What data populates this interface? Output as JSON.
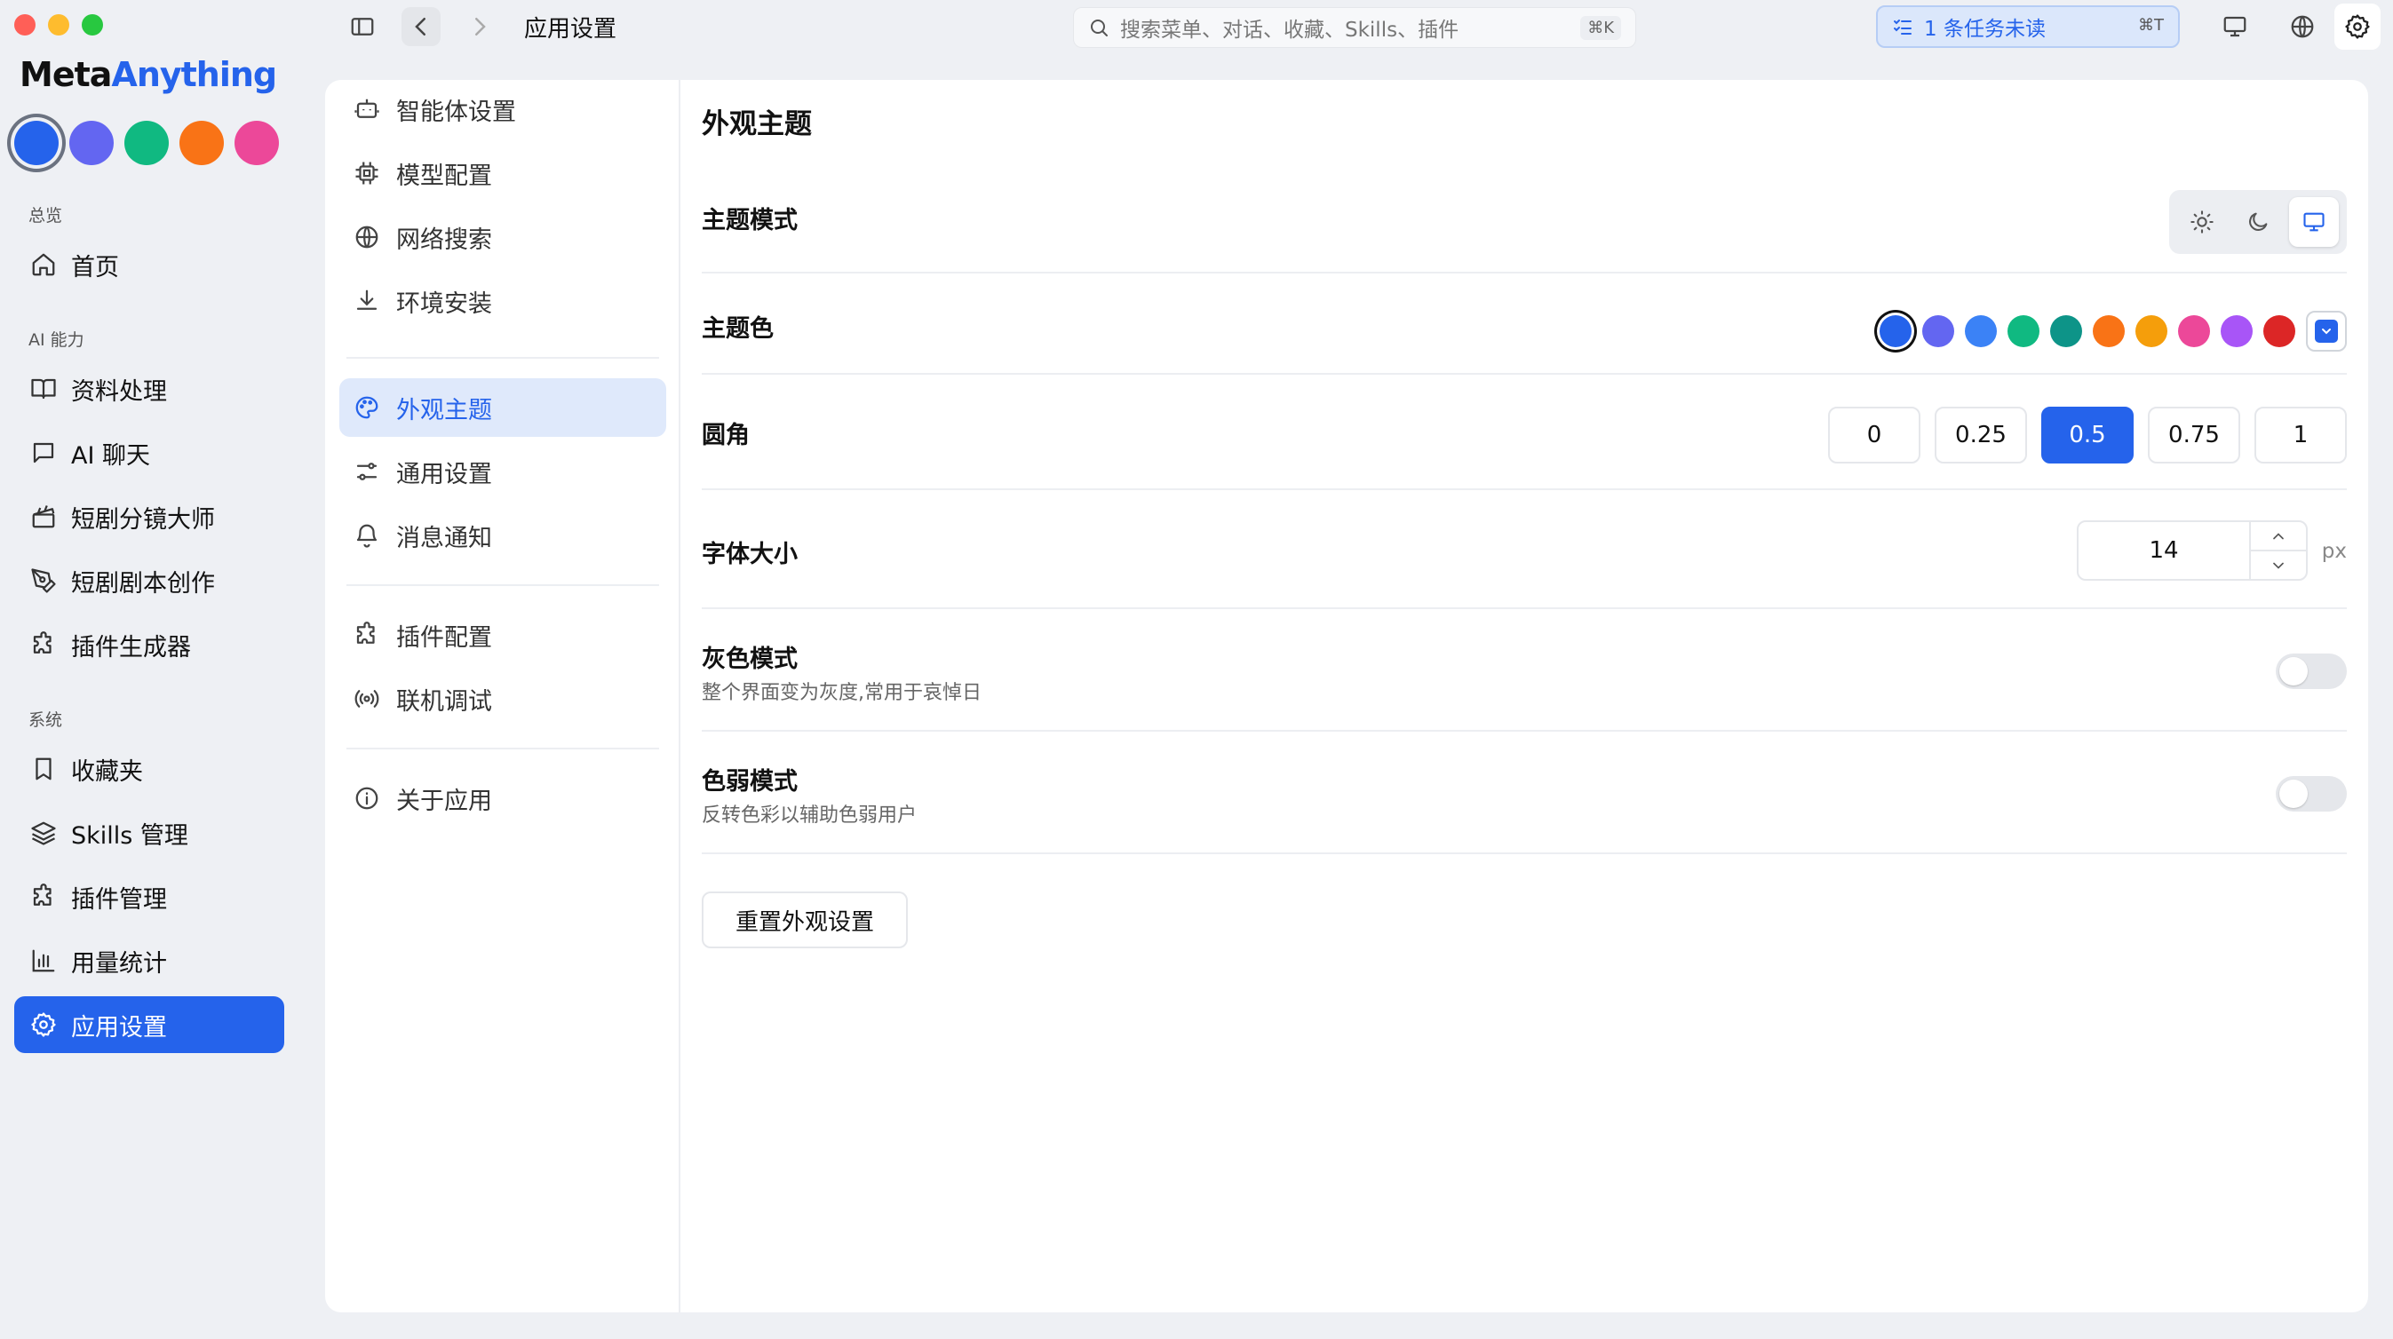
{
  "window": {
    "traffic_lights": [
      "#ff5f57",
      "#febc2e",
      "#28c840"
    ]
  },
  "brand": {
    "part1": "Meta",
    "part2": "Anything",
    "accent": "#2563eb"
  },
  "brand_swatches": [
    "#2563eb",
    "#6366f1",
    "#10b981",
    "#f97316",
    "#ec4899"
  ],
  "sidebar": {
    "sections": [
      {
        "title": "总览",
        "items": [
          {
            "label": "首页",
            "icon": "home-icon"
          }
        ]
      },
      {
        "title": "AI 能力",
        "items": [
          {
            "label": "资料处理",
            "icon": "book-open-icon"
          },
          {
            "label": "AI 聊天",
            "icon": "message-square-icon"
          },
          {
            "label": "短剧分镜大师",
            "icon": "clapperboard-icon"
          },
          {
            "label": "短剧剧本创作",
            "icon": "pen-tool-icon"
          },
          {
            "label": "插件生成器",
            "icon": "puzzle-icon"
          }
        ]
      },
      {
        "title": "系统",
        "items": [
          {
            "label": "收藏夹",
            "icon": "bookmark-icon"
          },
          {
            "label": "Skills 管理",
            "icon": "layers-icon"
          },
          {
            "label": "插件管理",
            "icon": "puzzle-icon"
          },
          {
            "label": "用量统计",
            "icon": "bar-chart-icon"
          },
          {
            "label": "应用设置",
            "icon": "gear-icon",
            "active": true
          }
        ]
      }
    ]
  },
  "topbar": {
    "breadcrumb": "应用设置",
    "search_placeholder": "搜索菜单、对话、收藏、Skills、插件",
    "search_shortcut": "⌘K",
    "task_label": "1 条任务未读",
    "task_shortcut": "⌘T"
  },
  "settings_nav": {
    "groups": [
      [
        {
          "label": "智能体设置",
          "icon": "bot-icon"
        },
        {
          "label": "模型配置",
          "icon": "cpu-icon"
        },
        {
          "label": "网络搜索",
          "icon": "globe-icon"
        },
        {
          "label": "环境安装",
          "icon": "download-icon"
        }
      ],
      [
        {
          "label": "外观主题",
          "icon": "palette-icon",
          "active": true
        },
        {
          "label": "通用设置",
          "icon": "sliders-icon"
        },
        {
          "label": "消息通知",
          "icon": "bell-icon"
        }
      ],
      [
        {
          "label": "插件配置",
          "icon": "puzzle-icon"
        },
        {
          "label": "联机调试",
          "icon": "radio-icon"
        }
      ],
      [
        {
          "label": "关于应用",
          "icon": "info-icon"
        }
      ]
    ]
  },
  "appearance": {
    "title": "外观主题",
    "theme_mode": {
      "label": "主题模式",
      "options": [
        "sun-icon",
        "moon-icon",
        "monitor-icon"
      ],
      "selected": "monitor-icon"
    },
    "theme_color": {
      "label": "主题色",
      "colors": [
        "#2563eb",
        "#6366f1",
        "#3b82f6",
        "#10b981",
        "#0d9488",
        "#f97316",
        "#f59e0b",
        "#ec4899",
        "#a855f7",
        "#dc2626"
      ],
      "selected_index": 0
    },
    "radius": {
      "label": "圆角",
      "options": [
        "0",
        "0.25",
        "0.5",
        "0.75",
        "1"
      ],
      "selected": "0.5"
    },
    "font_size": {
      "label": "字体大小",
      "value": "14",
      "unit": "px"
    },
    "gray_mode": {
      "label": "灰色模式",
      "desc": "整个界面变为灰度,常用于哀悼日",
      "on": false
    },
    "color_weak": {
      "label": "色弱模式",
      "desc": "反转色彩以辅助色弱用户",
      "on": false
    },
    "reset_label": "重置外观设置"
  }
}
